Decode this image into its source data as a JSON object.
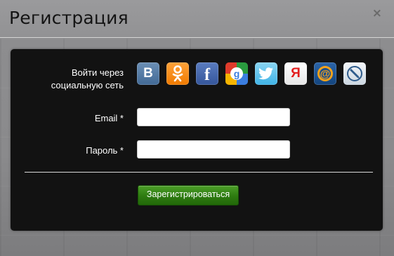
{
  "dialog": {
    "title": "Регистрация",
    "close_glyph": "×"
  },
  "social": {
    "label_line1": "Войти через",
    "label_line2": "социальную сеть",
    "providers": [
      {
        "name": "vkontakte-icon",
        "glyph": "В",
        "color": "#4a76a8"
      },
      {
        "name": "odnoklassniki-icon",
        "glyph": "",
        "color": "#f7931e"
      },
      {
        "name": "facebook-icon",
        "glyph": "f",
        "color": "#3b5998"
      },
      {
        "name": "google-icon",
        "glyph": "g",
        "color": "#4285f4"
      },
      {
        "name": "twitter-icon",
        "glyph": "",
        "color": "#55acee"
      },
      {
        "name": "yandex-icon",
        "glyph": "Я",
        "color": "#e21e1e"
      },
      {
        "name": "mailru-icon",
        "glyph": "@",
        "color": "#168de2"
      },
      {
        "name": "livejournal-icon",
        "glyph": "",
        "color": "#2f5c8c"
      }
    ]
  },
  "form": {
    "email_label": "Email *",
    "email_value": "",
    "password_label": "Пароль *",
    "password_value": "",
    "submit_label": "Зарегистрироваться"
  }
}
